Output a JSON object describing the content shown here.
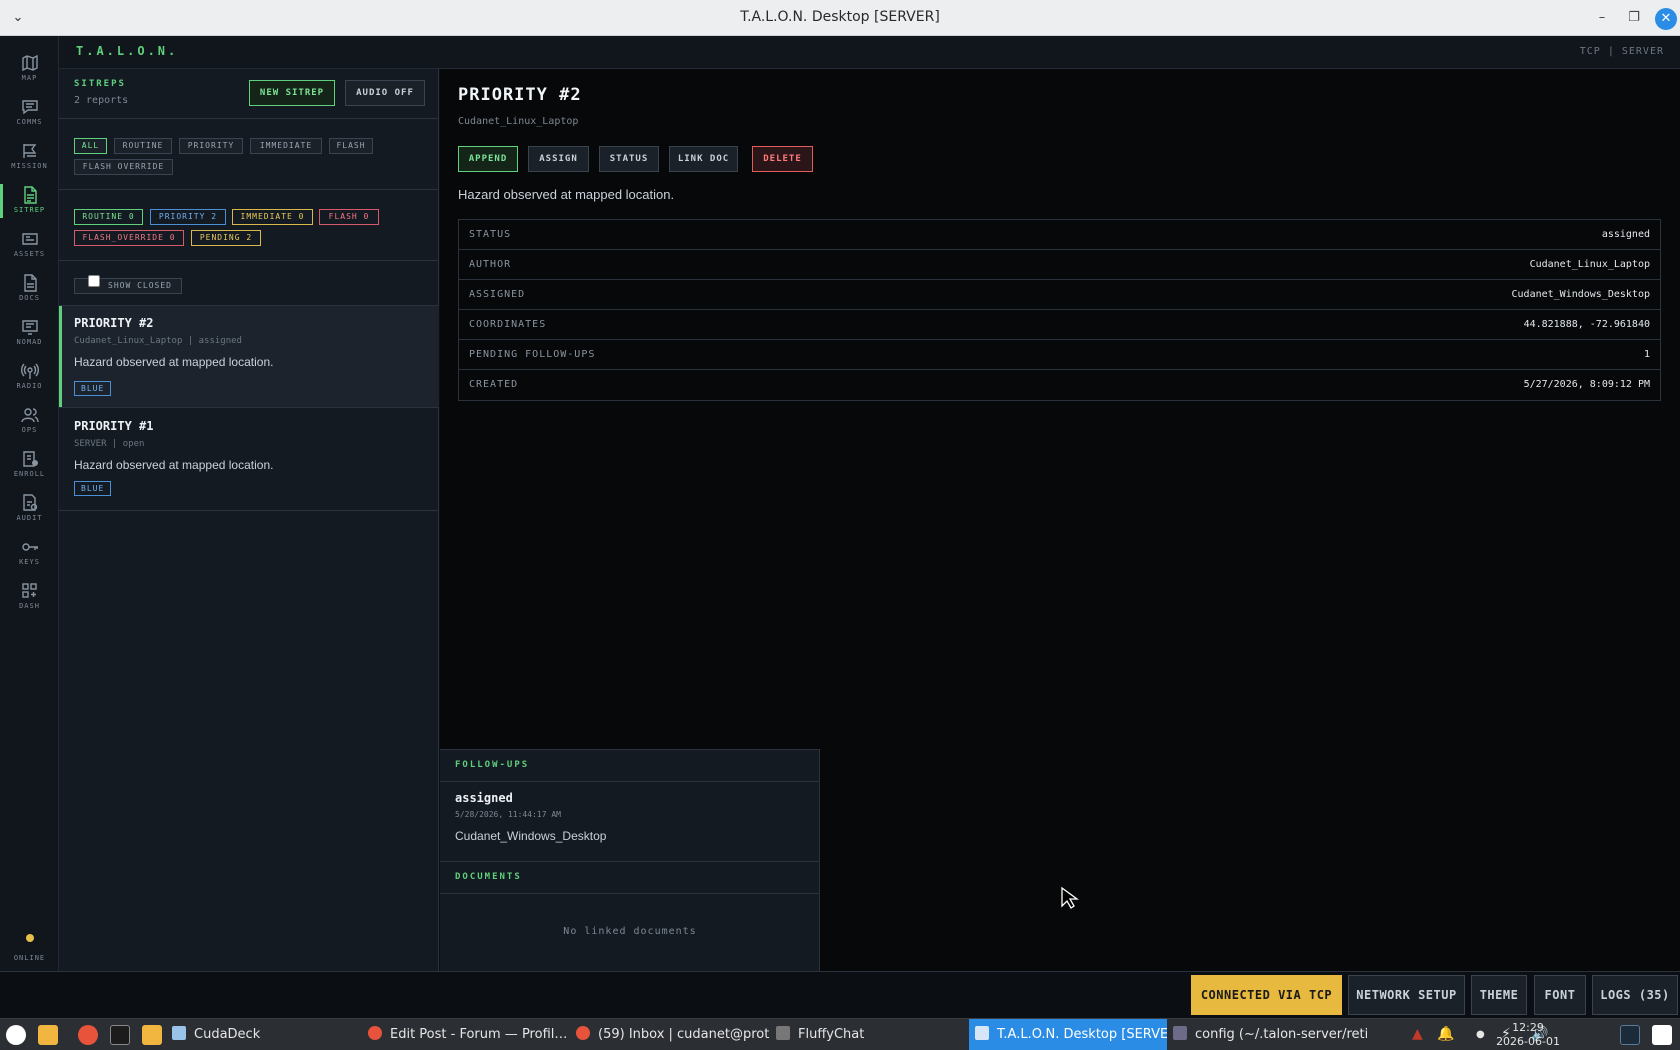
{
  "window": {
    "title": "T.A.L.O.N. Desktop [SERVER]"
  },
  "app": {
    "brand": "T.A.L.O.N.",
    "mode": "TCP | SERVER"
  },
  "rail": {
    "items": [
      {
        "label": "MAP",
        "icon": "map-icon"
      },
      {
        "label": "COMMS",
        "icon": "chat-icon"
      },
      {
        "label": "MISSION",
        "icon": "flag-icon"
      },
      {
        "label": "SITREP",
        "icon": "report-icon",
        "active": true
      },
      {
        "label": "ASSETS",
        "icon": "assets-icon"
      },
      {
        "label": "DOCS",
        "icon": "document-icon"
      },
      {
        "label": "NOMAD",
        "icon": "nomad-icon"
      },
      {
        "label": "RADIO",
        "icon": "radio-icon"
      },
      {
        "label": "OPS",
        "icon": "users-icon"
      },
      {
        "label": "ENROLL",
        "icon": "enroll-icon"
      },
      {
        "label": "AUDIT",
        "icon": "audit-icon"
      },
      {
        "label": "KEYS",
        "icon": "key-icon"
      },
      {
        "label": "DASH",
        "icon": "dashboard-icon"
      }
    ],
    "status": "ONLINE"
  },
  "list": {
    "title": "SITREPS",
    "count": "2 reports",
    "new_label": "NEW SITREP",
    "audio_label": "AUDIO OFF",
    "filters": [
      "ALL",
      "ROUTINE",
      "PRIORITY",
      "IMMEDIATE",
      "FLASH",
      "FLASH OVERRIDE"
    ],
    "counts": [
      {
        "label": "ROUTINE 0",
        "color": "#5fd07c"
      },
      {
        "label": "PRIORITY 2",
        "color": "#4b8fd6"
      },
      {
        "label": "IMMEDIATE 0",
        "color": "#d9b84a"
      },
      {
        "label": "FLASH 0",
        "color": "#d65a6a"
      },
      {
        "label": "FLASH_OVERRIDE 0",
        "color": "#d65a6a"
      },
      {
        "label": "PENDING 2",
        "color": "#d9b84a"
      }
    ],
    "show_closed": "SHOW CLOSED",
    "cards": [
      {
        "title": "PRIORITY #2",
        "meta": "Cudanet_Linux_Laptop | assigned",
        "desc": "Hazard observed at mapped location.",
        "tag": "BLUE"
      },
      {
        "title": "PRIORITY #1",
        "meta": "SERVER | open",
        "desc": "Hazard observed at mapped location.",
        "tag": "BLUE"
      }
    ]
  },
  "detail": {
    "title": "PRIORITY #2",
    "author_sub": "Cudanet_Linux_Laptop",
    "actions": {
      "append": "APPEND",
      "assign": "ASSIGN",
      "status": "STATUS",
      "link_doc": "LINK DOC",
      "delete": "DELETE"
    },
    "description": "Hazard observed at mapped location.",
    "rows": [
      {
        "key": "STATUS",
        "value": "assigned"
      },
      {
        "key": "AUTHOR",
        "value": "Cudanet_Linux_Laptop"
      },
      {
        "key": "ASSIGNED",
        "value": "Cudanet_Windows_Desktop"
      },
      {
        "key": "COORDINATES",
        "value": "44.821888, -72.961840"
      },
      {
        "key": "PENDING FOLLOW-UPS",
        "value": "1"
      },
      {
        "key": "CREATED",
        "value": "5/27/2026, 8:09:12 PM"
      }
    ],
    "followups_title": "FOLLOW-UPS",
    "followup": {
      "title": "assigned",
      "time": "5/28/2026, 11:44:17 AM",
      "body": "Cudanet_Windows_Desktop"
    },
    "documents_title": "DOCUMENTS",
    "no_docs": "No linked documents"
  },
  "statusbar": {
    "connection": "CONNECTED VIA TCP",
    "network": "NETWORK SETUP",
    "theme": "THEME",
    "font": "FONT",
    "logs": "LOGS (35)"
  },
  "taskbar": {
    "tasks": [
      {
        "label": "CudaDeck"
      },
      {
        "label": "Edit Post - Forum — Profil…"
      },
      {
        "label": "(59) Inbox | cudanet@prot…"
      },
      {
        "label": "FluffyChat"
      },
      {
        "label": "T.A.L.O.N. Desktop [SERVER]",
        "active": true
      },
      {
        "label": "config (~/.talon-server/reti…"
      }
    ],
    "time": "12:29",
    "date": "2026-06-01"
  }
}
